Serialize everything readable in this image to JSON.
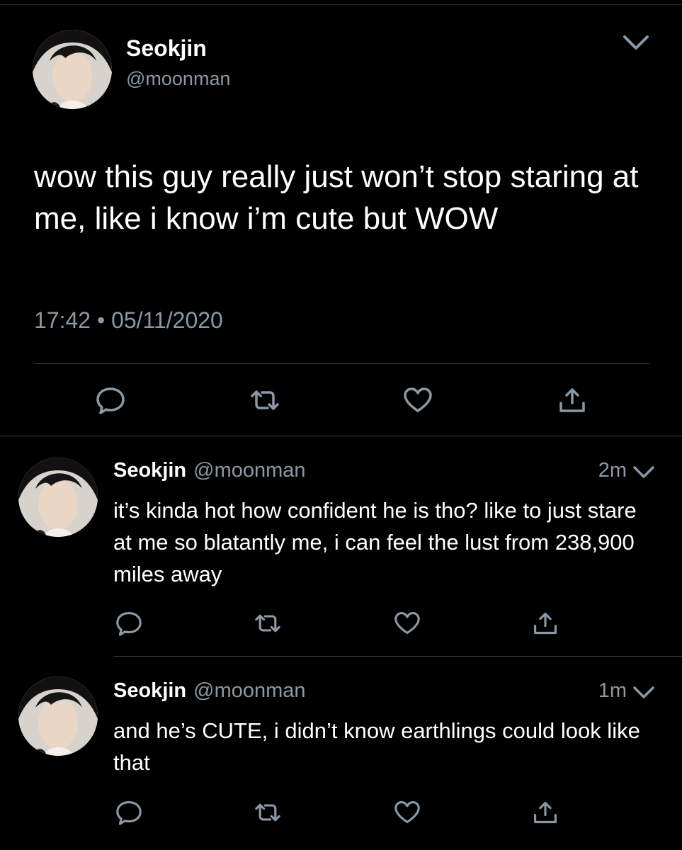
{
  "main_tweet": {
    "display_name": "Seokjin",
    "handle": "@moonman",
    "text": "wow this guy really just won’t stop staring at me, like i know i’m cute but WOW",
    "time": "17:42",
    "dot": "•",
    "date": "05/11/2020"
  },
  "replies": [
    {
      "display_name": "Seokjin",
      "handle": "@moonman",
      "age": "2m",
      "text": "it’s kinda hot how confident he is tho? like to just stare at me so blatantly me, i can feel the lust from 238,900 miles away"
    },
    {
      "display_name": "Seokjin",
      "handle": "@moonman",
      "age": "1m",
      "text": "and he’s CUTE, i didn’t know earthlings could look like that"
    }
  ],
  "icons": [
    "reply-icon",
    "retweet-icon",
    "like-icon",
    "share-icon",
    "chevron-down-icon"
  ],
  "colors": {
    "background": "#000000",
    "text": "#ffffff",
    "secondary_text": "#8b98a5",
    "divider": "#38444d"
  }
}
